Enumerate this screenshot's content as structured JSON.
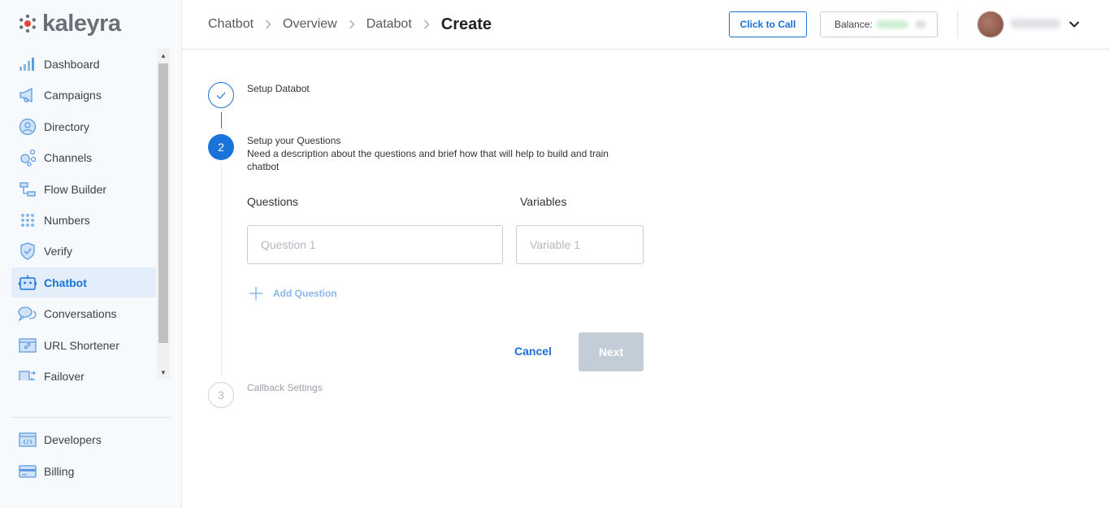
{
  "brand": {
    "name": "kaleyra",
    "accent": "#1a73d9",
    "logo_color": "#e8413a"
  },
  "sidebar": {
    "items": [
      {
        "label": "Dashboard",
        "icon": "bar-chart-icon"
      },
      {
        "label": "Campaigns",
        "icon": "megaphone-icon"
      },
      {
        "label": "Directory",
        "icon": "person-circle-icon"
      },
      {
        "label": "Channels",
        "icon": "channels-icon"
      },
      {
        "label": "Flow Builder",
        "icon": "flow-builder-icon"
      },
      {
        "label": "Numbers",
        "icon": "dial-pad-icon"
      },
      {
        "label": "Verify",
        "icon": "shield-check-icon"
      },
      {
        "label": "Chatbot",
        "icon": "robot-icon",
        "active": true
      },
      {
        "label": "Conversations",
        "icon": "chat-bubbles-icon"
      },
      {
        "label": "URL Shortener",
        "icon": "link-icon"
      },
      {
        "label": "Failover",
        "icon": "failover-icon"
      }
    ],
    "bottom_items": [
      {
        "label": "Developers",
        "icon": "code-icon"
      },
      {
        "label": "Billing",
        "icon": "credit-card-icon"
      }
    ]
  },
  "header": {
    "breadcrumb": [
      "Chatbot",
      "Overview",
      "Databot",
      "Create"
    ],
    "click_to_call": "Click to Call",
    "balance_label": "Balance:"
  },
  "stepper": {
    "step1": {
      "title": "Setup Databot"
    },
    "step2": {
      "number": "2",
      "title": "Setup your Questions",
      "description": "Need a description about the questions and brief how that will help to build and train chatbot"
    },
    "step3": {
      "number": "3",
      "title": "Callback Settings"
    }
  },
  "form": {
    "questions_label": "Questions",
    "variables_label": "Variables",
    "question_placeholder": "Question 1",
    "variable_placeholder": "Variable 1",
    "add_question": "Add Question",
    "cancel": "Cancel",
    "next": "Next"
  }
}
